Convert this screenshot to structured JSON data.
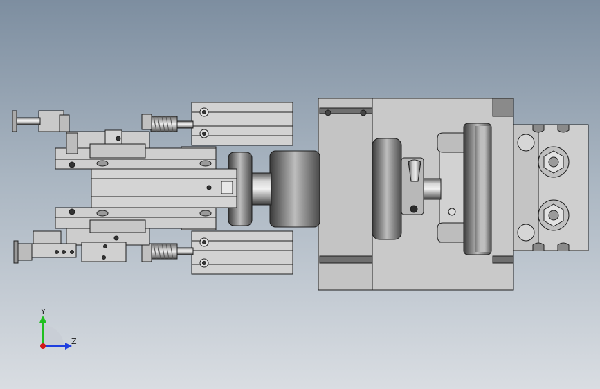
{
  "viewport": {
    "background_top": "#7d8ea0",
    "background_bottom": "#d9dde2",
    "part_fill": "#c9c9c9",
    "edge_color": "#1e1e1e"
  },
  "triad": {
    "y_label": "Y",
    "z_label": "Z",
    "y_color": "#1fbf1f",
    "z_color": "#1f3fdf",
    "x_color": "#d01818"
  }
}
